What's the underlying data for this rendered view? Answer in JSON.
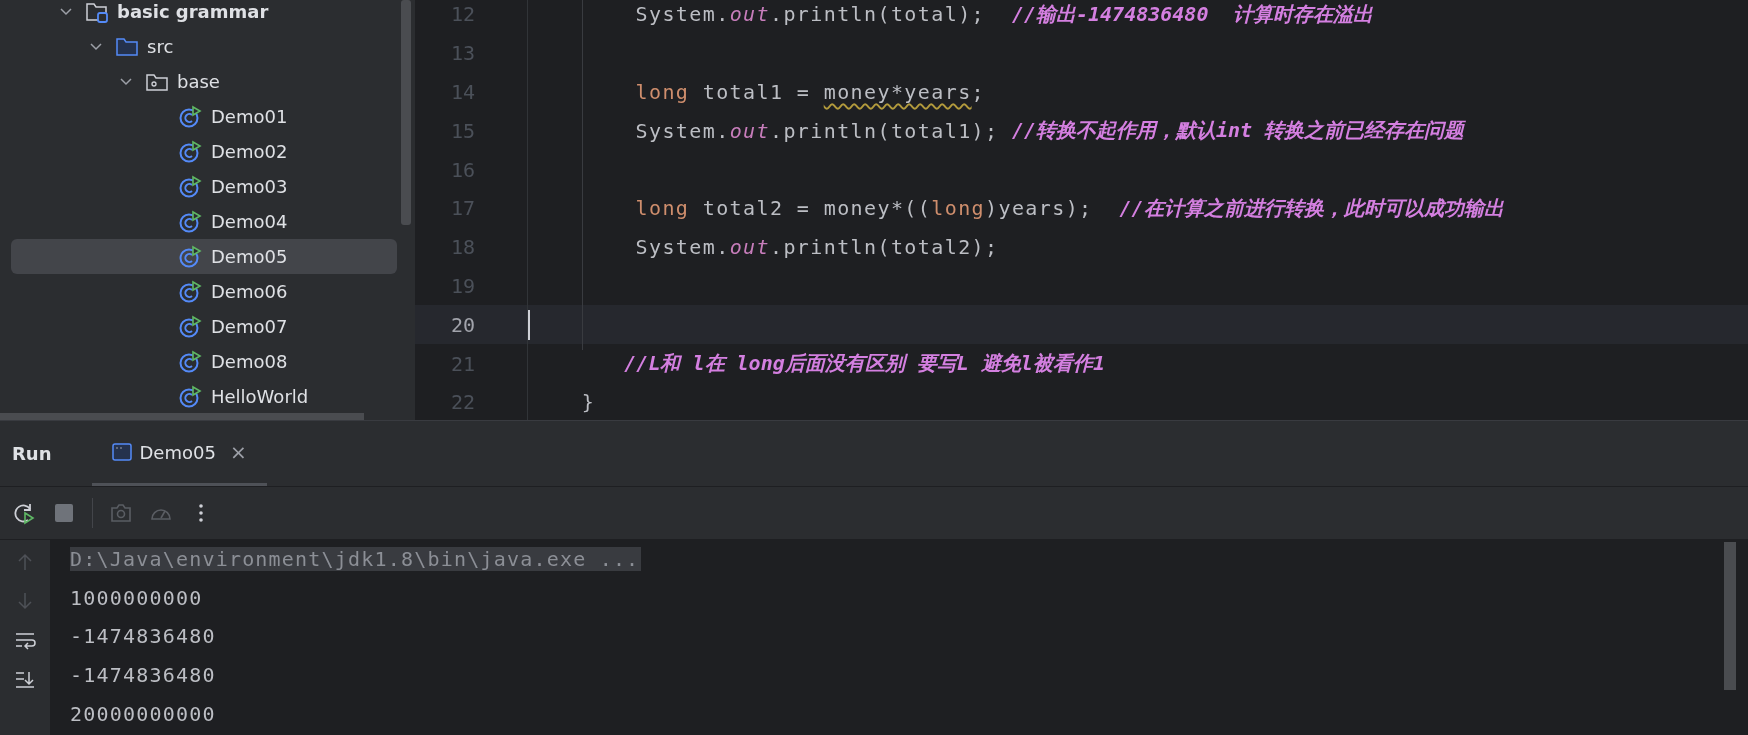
{
  "project_tree": {
    "items": [
      {
        "label": "basic grammar",
        "kind": "module",
        "expanded": true,
        "selected": false,
        "children": [
          {
            "label": "src",
            "kind": "folder",
            "expanded": true,
            "selected": false,
            "children": [
              {
                "label": "base",
                "kind": "package",
                "expanded": true,
                "selected": false,
                "children": [
                  {
                    "label": "Demo01",
                    "kind": "class",
                    "selected": false
                  },
                  {
                    "label": "Demo02",
                    "kind": "class",
                    "selected": false
                  },
                  {
                    "label": "Demo03",
                    "kind": "class",
                    "selected": false
                  },
                  {
                    "label": "Demo04",
                    "kind": "class",
                    "selected": false
                  },
                  {
                    "label": "Demo05",
                    "kind": "class",
                    "selected": true
                  },
                  {
                    "label": "Demo06",
                    "kind": "class",
                    "selected": false
                  },
                  {
                    "label": "Demo07",
                    "kind": "class",
                    "selected": false
                  },
                  {
                    "label": "Demo08",
                    "kind": "class",
                    "selected": false
                  },
                  {
                    "label": "HelloWorld",
                    "kind": "class",
                    "selected": false
                  }
                ]
              }
            ]
          }
        ]
      }
    ]
  },
  "editor": {
    "lines": [
      {
        "number": "12",
        "current": false,
        "tokens": [
          {
            "kind": "plain",
            "text": "        System."
          },
          {
            "kind": "field",
            "text": "out"
          },
          {
            "kind": "plain",
            "text": ".println(total);  "
          },
          {
            "kind": "comment",
            "text": "//输出-1474836480  计算时存在溢出"
          }
        ]
      },
      {
        "number": "13",
        "current": false
      },
      {
        "number": "14",
        "current": false,
        "tokens": [
          {
            "kind": "keyword",
            "text": "        long"
          },
          {
            "kind": "plain",
            "text": " total1 = "
          },
          {
            "kind": "warning",
            "text": "money*years"
          },
          {
            "kind": "plain",
            "text": ";"
          }
        ]
      },
      {
        "number": "15",
        "current": false,
        "tokens": [
          {
            "kind": "plain",
            "text": "        System."
          },
          {
            "kind": "field",
            "text": "out"
          },
          {
            "kind": "plain",
            "text": ".println(total1); "
          },
          {
            "kind": "comment",
            "text": "//转换不起作用，默认int 转换之前已经存在问题"
          }
        ]
      },
      {
        "number": "16",
        "current": false
      },
      {
        "number": "17",
        "current": false,
        "tokens": [
          {
            "kind": "keyword",
            "text": "        long"
          },
          {
            "kind": "plain",
            "text": " total2 = money*(("
          },
          {
            "kind": "keyword",
            "text": "long"
          },
          {
            "kind": "plain",
            "text": ")years);  "
          },
          {
            "kind": "comment",
            "text": "//在计算之前进行转换，此时可以成功输出"
          }
        ]
      },
      {
        "number": "18",
        "current": false,
        "tokens": [
          {
            "kind": "plain",
            "text": "        System."
          },
          {
            "kind": "field",
            "text": "out"
          },
          {
            "kind": "plain",
            "text": ".println(total2);"
          }
        ]
      },
      {
        "number": "19",
        "current": false
      },
      {
        "number": "20",
        "current": true
      },
      {
        "number": "21",
        "current": false,
        "tokens": [
          {
            "kind": "comment",
            "text": "        //L和 l在 long后面没有区别 要写L 避免l被看作1"
          }
        ]
      },
      {
        "number": "22",
        "current": false,
        "tokens": [
          {
            "kind": "plain",
            "text": "    }"
          }
        ]
      }
    ]
  },
  "run_panel": {
    "title": "Run",
    "tabs": [
      {
        "label": "Demo05",
        "selected": true,
        "close": "×"
      }
    ],
    "console": [
      {
        "kind": "command",
        "text": "D:\\Java\\environment\\jdk1.8\\bin\\java.exe ..."
      },
      {
        "kind": "output",
        "text": "1000000000"
      },
      {
        "kind": "output",
        "text": "-1474836480"
      },
      {
        "kind": "output",
        "text": "-1474836480"
      },
      {
        "kind": "output",
        "text": "20000000000"
      }
    ]
  }
}
